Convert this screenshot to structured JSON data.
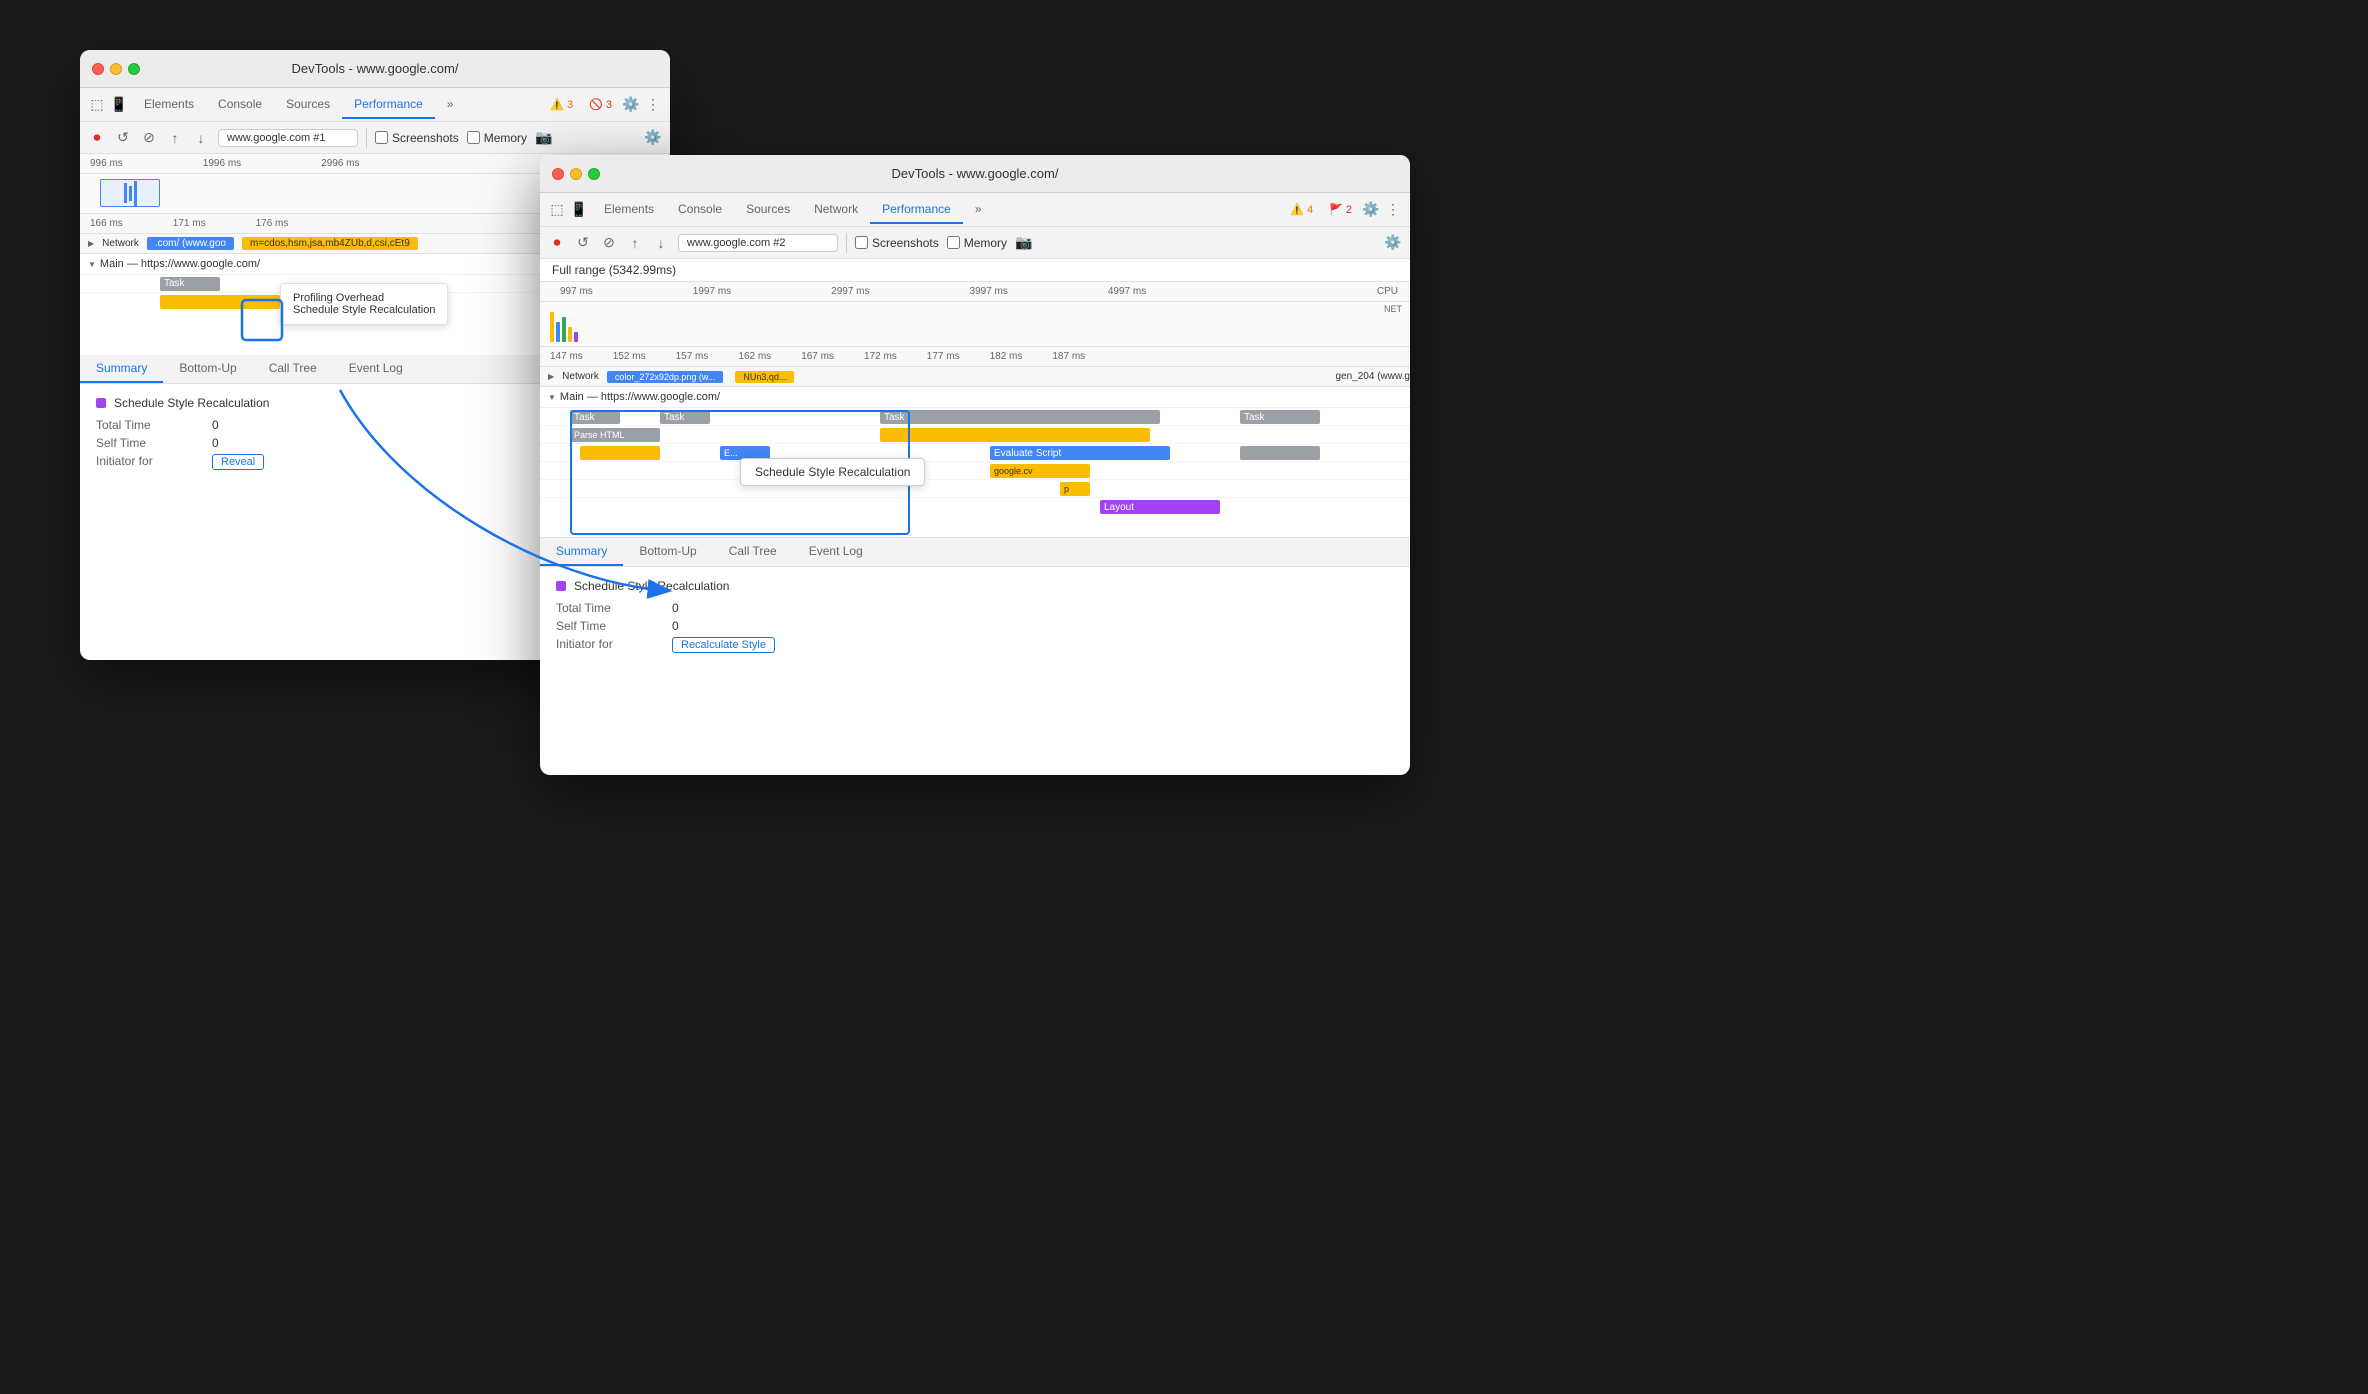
{
  "window1": {
    "title": "DevTools - www.google.com/",
    "tabs": [
      "Elements",
      "Console",
      "Sources",
      "Performance",
      "»"
    ],
    "active_tab": "Performance",
    "url": "www.google.com #1",
    "warnings": "3",
    "errors": "3",
    "screenshots_label": "Screenshots",
    "memory_label": "Memory",
    "timeline": {
      "timestamps": [
        "996 ms",
        "1996 ms",
        "2996 ms"
      ],
      "sub_timestamps": [
        "166 ms",
        "171 ms",
        "176 ms"
      ],
      "network_label": "Network",
      "network_url": ".com/ (www.goo",
      "network_params": "m=cdos,hsm,jsa,mb4ZUb,d,csi,cEt9",
      "main_label": "Main — https://www.google.com/",
      "task_label": "Task"
    },
    "tooltip": {
      "line1": "Profiling Overhead",
      "line2": "Schedule Style Recalculation"
    },
    "bottom_tabs": [
      "Summary",
      "Bottom-Up",
      "Call Tree",
      "Event Log"
    ],
    "active_bottom_tab": "Summary",
    "summary": {
      "title": "Schedule Style Recalculation",
      "total_time_label": "Total Time",
      "total_time_value": "0",
      "self_time_label": "Self Time",
      "self_time_value": "0",
      "initiator_label": "Initiator for",
      "initiator_link": "Reveal"
    }
  },
  "window2": {
    "title": "DevTools - www.google.com/",
    "tabs": [
      "Elements",
      "Console",
      "Sources",
      "Network",
      "Performance",
      "»"
    ],
    "active_tab": "Performance",
    "url": "www.google.com #2",
    "warnings": "4",
    "errors": "2",
    "screenshots_label": "Screenshots",
    "memory_label": "Memory",
    "full_range_label": "Full range (5342.99ms)",
    "timeline": {
      "timestamps": [
        "997 ms",
        "1997 ms",
        "2997 ms",
        "3997 ms",
        "4997 ms"
      ],
      "sub_timestamps": [
        "147 ms",
        "152 ms",
        "157 ms",
        "162 ms",
        "167 ms",
        "172 ms",
        "177 ms",
        "182 ms",
        "187 ms"
      ],
      "network_label": "Network",
      "network_file": "color_272x92dp.png (w...",
      "network_params": "NUn3,qd...",
      "network_gen": "gen_204 (www.g",
      "main_label": "Main — https://www.google.com/",
      "task_label": "Task",
      "cpu_label": "CPU",
      "net_label": "NET"
    },
    "task_items": [
      "Task",
      "Task",
      "Task",
      "Task"
    ],
    "sub_items": [
      "E...",
      "Evaluate Script",
      "google.cv",
      "p",
      "Layout"
    ],
    "tooltip": "Schedule Style Recalculation",
    "bottom_tabs": [
      "Summary",
      "Bottom-Up",
      "Call Tree",
      "Event Log"
    ],
    "active_bottom_tab": "Summary",
    "summary": {
      "title": "Schedule Style Recalculation",
      "total_time_label": "Total Time",
      "total_time_value": "0",
      "self_time_label": "Self Time",
      "self_time_value": "0",
      "initiator_label": "Initiator for",
      "initiator_link": "Recalculate Style"
    }
  }
}
